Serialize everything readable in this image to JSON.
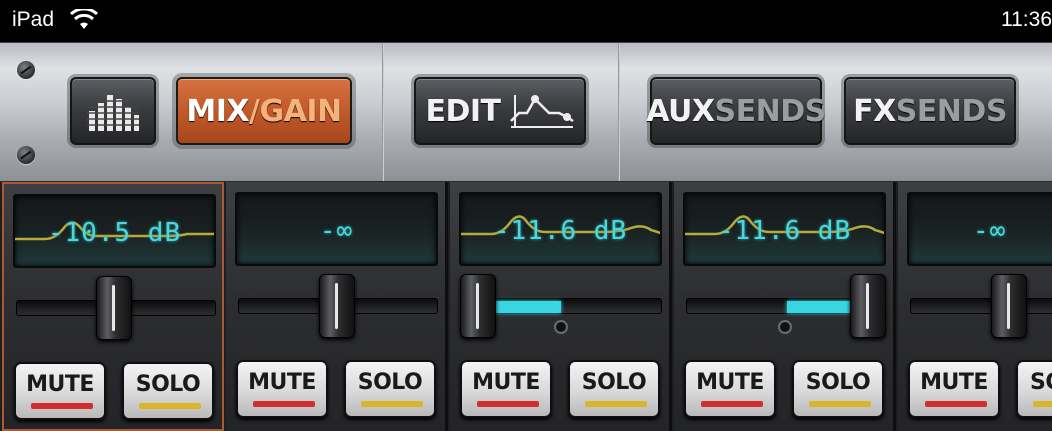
{
  "status_bar": {
    "device": "iPad",
    "time": "11:36"
  },
  "toolbar": {
    "meters_icon": "meter-bars-icon",
    "mix_gain": {
      "part1": "MIX",
      "part2": "/GAIN",
      "active": true
    },
    "edit": {
      "label": "EDIT",
      "icon": "eq-curve-icon"
    },
    "aux_sends": {
      "part1": "AUX",
      "part2": "SENDS"
    },
    "fx_sends": {
      "part1": "FX",
      "part2": "SENDS"
    }
  },
  "colors": {
    "accent": "#c25a2a",
    "lcd_text": "#4fd6dc",
    "fader_fill": "#37d6e0",
    "mute_led": "#d22d2d",
    "solo_led": "#d9b52a"
  },
  "channels": [
    {
      "value": "-10.5 dB",
      "mute": "MUTE",
      "solo": "SOLO",
      "selected": true,
      "eq_curve": true,
      "pan": 0.0
    },
    {
      "value": "-∞",
      "mute": "MUTE",
      "solo": "SOLO",
      "selected": false,
      "eq_curve": false,
      "pan": 0.0
    },
    {
      "value": "-11.6 dB",
      "mute": "MUTE",
      "solo": "SOLO",
      "selected": false,
      "eq_curve": true,
      "pan": -1.0
    },
    {
      "value": "-11.6 dB",
      "mute": "MUTE",
      "solo": "SOLO",
      "selected": false,
      "eq_curve": true,
      "pan": 1.0
    },
    {
      "value": "-∞",
      "mute": "MUTE",
      "solo": "SO",
      "selected": false,
      "eq_curve": false,
      "pan": 0.0
    }
  ]
}
